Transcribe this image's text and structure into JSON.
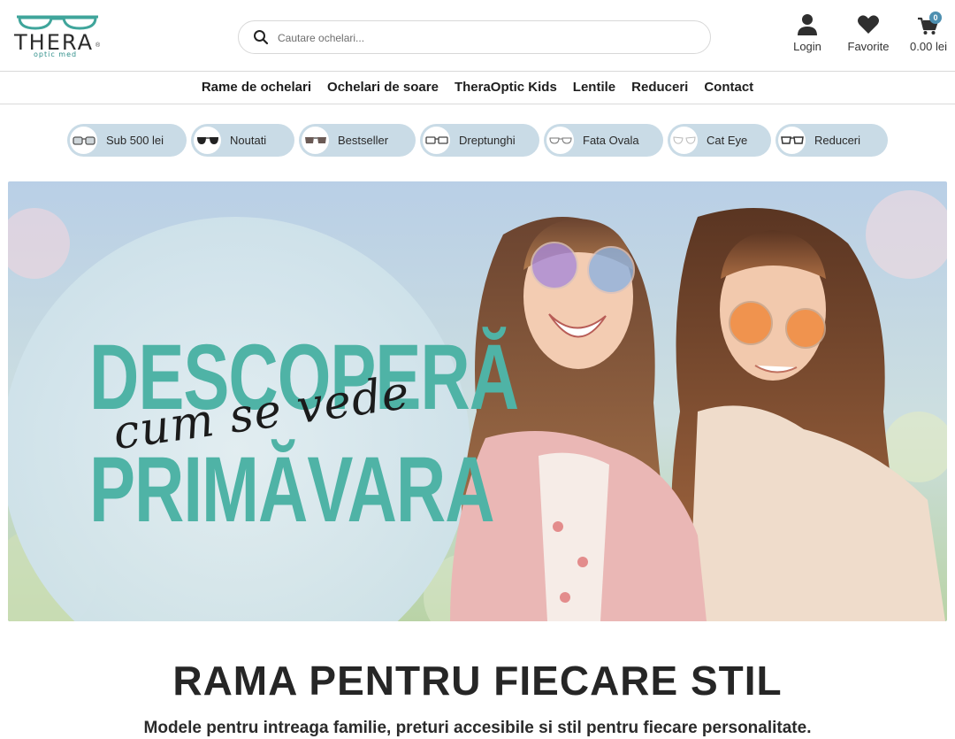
{
  "header": {
    "logo_text": "THERA",
    "logo_reg": "®",
    "logo_sub": "optic med",
    "search_placeholder": "Cautare ochelari...",
    "login_label": "Login",
    "favorites_label": "Favorite",
    "cart_total": "0.00 lei",
    "cart_count": "0"
  },
  "nav": {
    "items": [
      "Rame de ochelari",
      "Ochelari de soare",
      "TheraOptic Kids",
      "Lentile",
      "Reduceri",
      "Contact"
    ]
  },
  "categories": [
    {
      "label": "Sub 500 lei",
      "icon": "glasses-frame-icon"
    },
    {
      "label": "Noutati",
      "icon": "sunglasses-icon"
    },
    {
      "label": "Bestseller",
      "icon": "sunglasses-icon"
    },
    {
      "label": "Dreptunghi",
      "icon": "rectangle-glasses-icon"
    },
    {
      "label": "Fata Ovala",
      "icon": "oval-glasses-icon"
    },
    {
      "label": "Cat Eye",
      "icon": "cat-eye-glasses-icon"
    },
    {
      "label": "Reduceri",
      "icon": "glasses-frame-icon"
    }
  ],
  "banner": {
    "line1": "DESCOPERĂ",
    "script": "cum se vede",
    "line2": "PRIMĂVARA"
  },
  "section": {
    "title": "RAMA PENTRU FIECARE STIL",
    "subtitle": "Modele pentru intreaga familie, preturi accesibile si stil pentru fiecare personalitate."
  },
  "colors": {
    "accent_teal": "#4fb3a6",
    "chip_bg": "#c9dbe6",
    "badge_blue": "#4d8fb0"
  }
}
